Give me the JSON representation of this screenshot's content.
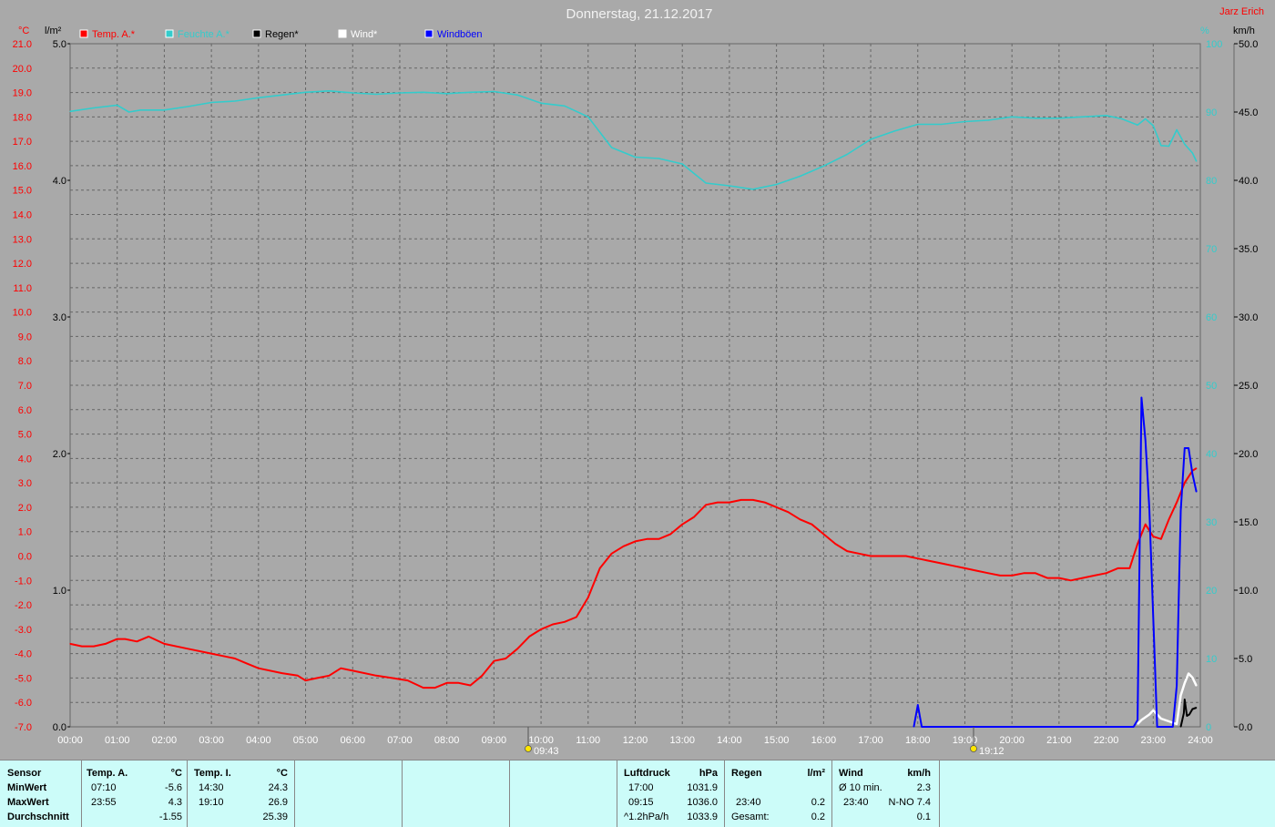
{
  "title": "Donnerstag, 21.12.2017",
  "author": "Jarz Erich",
  "axes": {
    "left_temp_unit": "°C",
    "left_rain_unit": "l/m²",
    "right_pct_unit": "%",
    "right_wind_unit": "km/h",
    "temp_ticks": [
      "21.0",
      "20.0",
      "19.0",
      "18.0",
      "17.0",
      "16.0",
      "15.0",
      "14.0",
      "13.0",
      "12.0",
      "11.0",
      "10.0",
      "9.0",
      "8.0",
      "7.0",
      "6.0",
      "5.0",
      "4.0",
      "3.0",
      "2.0",
      "1.0",
      "0.0",
      "-1.0",
      "-2.0",
      "-3.0",
      "-4.0",
      "-5.0",
      "-6.0",
      "-7.0"
    ],
    "rain_ticks": [
      "5.0",
      "4.0",
      "3.0",
      "2.0",
      "1.0",
      "0.0"
    ],
    "pct_ticks": [
      "100",
      "90",
      "80",
      "70",
      "60",
      "50",
      "40",
      "30",
      "20",
      "10",
      "0"
    ],
    "wind_ticks": [
      "50.0",
      "45.0",
      "40.0",
      "35.0",
      "30.0",
      "25.0",
      "20.0",
      "15.0",
      "10.0",
      "5.0",
      "0.0"
    ],
    "x_ticks": [
      "00:00",
      "01:00",
      "02:00",
      "03:00",
      "04:00",
      "05:00",
      "06:00",
      "07:00",
      "08:00",
      "09:00",
      "10:00",
      "11:00",
      "12:00",
      "13:00",
      "14:00",
      "15:00",
      "16:00",
      "17:00",
      "18:00",
      "19:00",
      "20:00",
      "21:00",
      "22:00",
      "23:00",
      "24:00"
    ],
    "sunrise": "09:43",
    "sunset": "19:12"
  },
  "colors": {
    "temp": "#ff0000",
    "humidity": "#33cccc",
    "rain": "#000000",
    "wind": "#ffffff",
    "gust": "#0000ff",
    "temp_axis": "#ff0000",
    "humidity_axis": "#33cccc"
  },
  "chart_data": {
    "type": "line",
    "title": "Donnerstag, 21.12.2017",
    "x_range": [
      "00:00",
      "24:00"
    ],
    "grid": true,
    "legend_position": "top",
    "y_axes": {
      "temp": {
        "label": "°C",
        "range": [
          -7.0,
          21.0
        ]
      },
      "rain": {
        "label": "l/m²",
        "range": [
          0.0,
          5.0
        ]
      },
      "humidity": {
        "label": "%",
        "range": [
          0,
          100
        ]
      },
      "wind": {
        "label": "km/h",
        "range": [
          0.0,
          50.0
        ]
      }
    },
    "series": [
      {
        "name": "Temp. A.*",
        "axis": "temp",
        "x": [
          "00:00",
          "00:15",
          "00:30",
          "00:45",
          "01:00",
          "01:10",
          "01:25",
          "01:40",
          "02:00",
          "02:30",
          "03:00",
          "03:15",
          "03:30",
          "03:45",
          "04:00",
          "04:30",
          "04:50",
          "05:00",
          "05:15",
          "05:30",
          "05:45",
          "06:00",
          "06:30",
          "06:50",
          "07:10",
          "07:30",
          "07:45",
          "08:00",
          "08:15",
          "08:30",
          "08:45",
          "09:00",
          "09:15",
          "09:30",
          "09:45",
          "10:00",
          "10:15",
          "10:30",
          "10:45",
          "11:00",
          "11:15",
          "11:30",
          "11:45",
          "12:00",
          "12:15",
          "12:30",
          "12:45",
          "13:00",
          "13:15",
          "13:30",
          "13:45",
          "14:00",
          "14:15",
          "14:30",
          "14:45",
          "15:00",
          "15:15",
          "15:30",
          "15:45",
          "16:00",
          "16:15",
          "16:30",
          "16:45",
          "17:00",
          "17:15",
          "17:30",
          "17:45",
          "18:00",
          "18:15",
          "18:30",
          "18:45",
          "19:00",
          "19:15",
          "19:30",
          "19:45",
          "20:00",
          "20:15",
          "20:30",
          "20:45",
          "21:00",
          "21:15",
          "21:30",
          "21:45",
          "22:00",
          "22:15",
          "22:30",
          "22:40",
          "22:50",
          "23:00",
          "23:10",
          "23:20",
          "23:30",
          "23:40",
          "23:50",
          "23:55"
        ],
        "values": [
          -3.6,
          -3.7,
          -3.7,
          -3.6,
          -3.4,
          -3.4,
          -3.5,
          -3.3,
          -3.6,
          -3.8,
          -4.0,
          -4.1,
          -4.2,
          -4.4,
          -4.6,
          -4.8,
          -4.9,
          -5.1,
          -5.0,
          -4.9,
          -4.6,
          -4.7,
          -4.9,
          -5.0,
          -5.1,
          -5.4,
          -5.4,
          -5.2,
          -5.2,
          -5.3,
          -4.9,
          -4.3,
          -4.2,
          -3.8,
          -3.3,
          -3.0,
          -2.8,
          -2.7,
          -2.5,
          -1.7,
          -0.5,
          0.1,
          0.4,
          0.6,
          0.7,
          0.7,
          0.9,
          1.3,
          1.6,
          2.1,
          2.2,
          2.2,
          2.3,
          2.3,
          2.2,
          2.0,
          1.8,
          1.5,
          1.3,
          0.9,
          0.5,
          0.2,
          0.1,
          0.0,
          0.0,
          0.0,
          0.0,
          -0.1,
          -0.2,
          -0.3,
          -0.4,
          -0.5,
          -0.6,
          -0.7,
          -0.8,
          -0.8,
          -0.7,
          -0.7,
          -0.9,
          -0.9,
          -1.0,
          -0.9,
          -0.8,
          -0.7,
          -0.5,
          -0.5,
          0.5,
          1.3,
          0.8,
          0.7,
          1.5,
          2.2,
          3.0,
          3.5,
          3.6
        ]
      },
      {
        "name": "Feuchte A.*",
        "axis": "humidity",
        "x": [
          "00:00",
          "00:30",
          "01:00",
          "01:15",
          "01:30",
          "02:00",
          "02:30",
          "03:00",
          "03:30",
          "04:00",
          "04:30",
          "05:00",
          "05:30",
          "06:00",
          "06:30",
          "07:00",
          "07:30",
          "08:00",
          "08:30",
          "09:00",
          "09:30",
          "10:00",
          "10:30",
          "11:00",
          "11:30",
          "12:00",
          "12:30",
          "13:00",
          "13:30",
          "14:00",
          "14:30",
          "15:00",
          "15:30",
          "16:00",
          "16:30",
          "17:00",
          "17:30",
          "18:00",
          "18:30",
          "19:00",
          "19:30",
          "20:00",
          "20:30",
          "21:00",
          "21:30",
          "22:00",
          "22:20",
          "22:40",
          "22:50",
          "23:00",
          "23:10",
          "23:20",
          "23:30",
          "23:40",
          "23:50",
          "23:55"
        ],
        "values": [
          90.1,
          90.6,
          91.0,
          90.0,
          90.3,
          90.3,
          90.8,
          91.4,
          91.6,
          92.1,
          92.5,
          92.9,
          93.1,
          92.8,
          92.6,
          92.8,
          92.9,
          92.7,
          92.9,
          93.0,
          92.5,
          91.3,
          90.9,
          89.3,
          84.8,
          83.4,
          83.2,
          82.4,
          79.6,
          79.2,
          78.7,
          79.4,
          80.6,
          82.1,
          83.8,
          86.0,
          87.2,
          88.2,
          88.2,
          88.6,
          88.8,
          89.3,
          89.1,
          89.1,
          89.3,
          89.5,
          89.0,
          88.1,
          89.0,
          88.0,
          85.1,
          85.0,
          87.4,
          85.3,
          84.0,
          82.8
        ]
      },
      {
        "name": "Regen*",
        "axis": "rain",
        "x": [
          "23:35",
          "23:37",
          "23:39",
          "23:40",
          "23:43",
          "23:46",
          "23:50",
          "23:55"
        ],
        "values": [
          0.0,
          0.05,
          0.1,
          0.2,
          0.08,
          0.09,
          0.13,
          0.14
        ]
      },
      {
        "name": "Wind*",
        "axis": "wind",
        "x": [
          "22:40",
          "22:45",
          "22:50",
          "22:55",
          "23:00",
          "23:05",
          "23:10",
          "23:20",
          "23:30",
          "23:35",
          "23:40",
          "23:45",
          "23:50",
          "23:55"
        ],
        "values": [
          0.2,
          0.5,
          0.7,
          0.9,
          1.2,
          0.9,
          0.6,
          0.4,
          0.2,
          2.3,
          3.2,
          3.9,
          3.6,
          3.0
        ]
      },
      {
        "name": "Windböen",
        "axis": "wind",
        "x": [
          "17:55",
          "18:00",
          "18:05",
          "22:35",
          "22:40",
          "22:45",
          "22:50",
          "22:55",
          "23:00",
          "23:05",
          "23:10",
          "23:15",
          "23:20",
          "23:25",
          "23:30",
          "23:35",
          "23:40",
          "23:45",
          "23:50",
          "23:55"
        ],
        "values": [
          0.0,
          1.6,
          0.0,
          0.0,
          0.5,
          24.1,
          21.0,
          16.0,
          8.0,
          0.0,
          0.0,
          0.0,
          0.0,
          0.0,
          3.0,
          15.8,
          20.4,
          20.4,
          18.5,
          17.2
        ]
      }
    ]
  },
  "stats": {
    "sensor_header": "Sensor",
    "row_labels": [
      "MinWert",
      "MaxWert",
      "Durchschnitt"
    ],
    "temp_a": {
      "title": "Temp. A.",
      "unit": "°C",
      "times": [
        "07:10",
        "23:55",
        ""
      ],
      "values": [
        "-5.6",
        "4.3",
        "-1.55"
      ]
    },
    "temp_i": {
      "title": "Temp. I.",
      "unit": "°C",
      "times": [
        "14:30",
        "19:10",
        ""
      ],
      "values": [
        "24.3",
        "26.9",
        "25.39"
      ]
    },
    "pressure": {
      "title": "Luftdruck",
      "unit": "hPa",
      "times": [
        "17:00",
        "09:15",
        "^1.2hPa/h"
      ],
      "values": [
        "1031.9",
        "1036.0",
        "1033.9"
      ]
    },
    "rain": {
      "title": "Regen",
      "unit": "l/m²",
      "times": [
        "",
        "23:40",
        "Gesamt:"
      ],
      "values": [
        "",
        "0.2",
        "0.2"
      ]
    },
    "wind": {
      "title": "Wind",
      "unit": "km/h",
      "times": [
        "Ø 10 min.",
        "23:40",
        ""
      ],
      "values": [
        "2.3",
        "N-NO 7.4",
        "0.1"
      ]
    }
  }
}
